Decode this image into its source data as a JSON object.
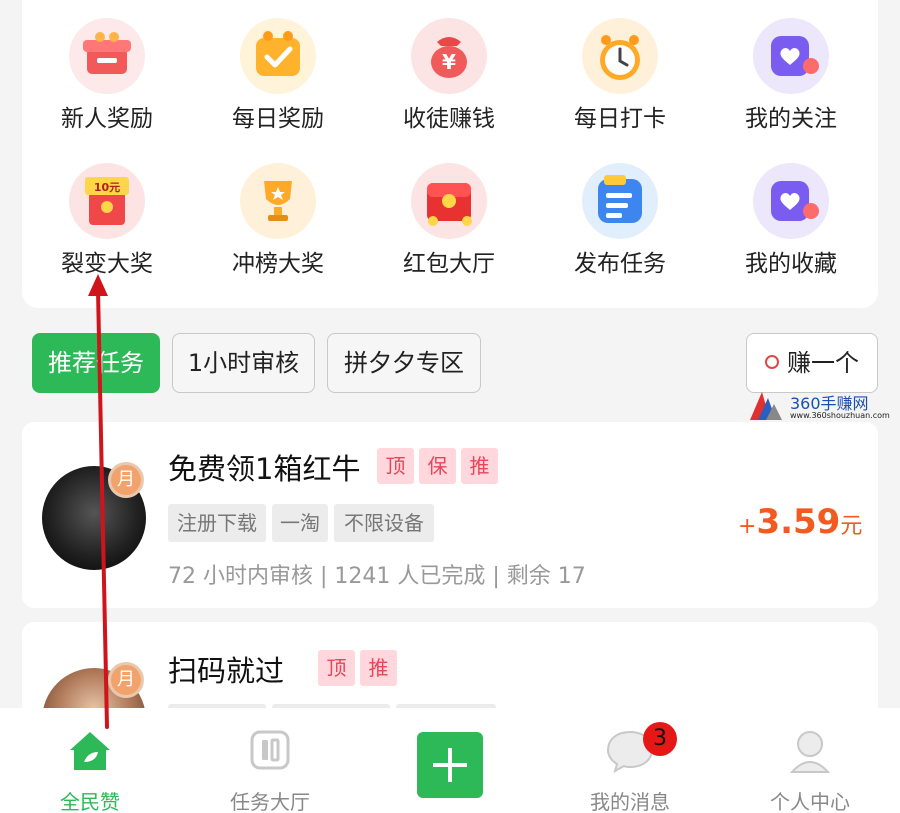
{
  "grid_items": [
    {
      "label": "新人奖励",
      "icon": "gift-box-icon"
    },
    {
      "label": "每日奖励",
      "icon": "daily-check-gift-icon"
    },
    {
      "label": "收徒赚钱",
      "icon": "money-bag-icon"
    },
    {
      "label": "每日打卡",
      "icon": "alarm-clock-icon"
    },
    {
      "label": "我的关注",
      "icon": "heart-follow-icon"
    },
    {
      "label": "裂变大奖",
      "icon": "red-envelope-icon",
      "note": "10元"
    },
    {
      "label": "冲榜大奖",
      "icon": "trophy-icon"
    },
    {
      "label": "红包大厅",
      "icon": "red-packet-hall-icon"
    },
    {
      "label": "发布任务",
      "icon": "publish-task-icon"
    },
    {
      "label": "我的收藏",
      "icon": "heart-favorite-icon"
    }
  ],
  "tabs": {
    "recommended": "推荐任务",
    "one_hour": "1小时审核",
    "pinduoduo": "拼夕夕专区",
    "earn_one": "赚一个"
  },
  "watermark": {
    "name": "360手赚网",
    "url": "www.360shouzhuan.com"
  },
  "tasks": [
    {
      "title": "免费领1箱红牛",
      "badge": "月",
      "flags": [
        "顶",
        "保",
        "推"
      ],
      "tags": [
        "注册下载",
        "一淘",
        "不限设备"
      ],
      "meta": "72 小时内审核 | 1241 人已完成 | 剩余 17",
      "price_sign": "+",
      "price": "3.59",
      "price_unit": "元"
    },
    {
      "title": "扫码就过",
      "badge": "月",
      "flags": [
        "顶",
        "推"
      ]
    }
  ],
  "bottom_nav": [
    {
      "label": "全民赞",
      "icon": "home-icon"
    },
    {
      "label": "任务大厅",
      "icon": "task-hall-icon"
    },
    {
      "label": "",
      "icon": "plus-icon"
    },
    {
      "label": "我的消息",
      "icon": "message-icon",
      "badge": "3"
    },
    {
      "label": "个人中心",
      "icon": "profile-icon"
    }
  ],
  "colors": {
    "accent": "#2eb958",
    "price": "#f25a1f",
    "flag_text": "#e6465a",
    "flag_bg": "#ffd7dc",
    "annotation": "#d0141c"
  }
}
